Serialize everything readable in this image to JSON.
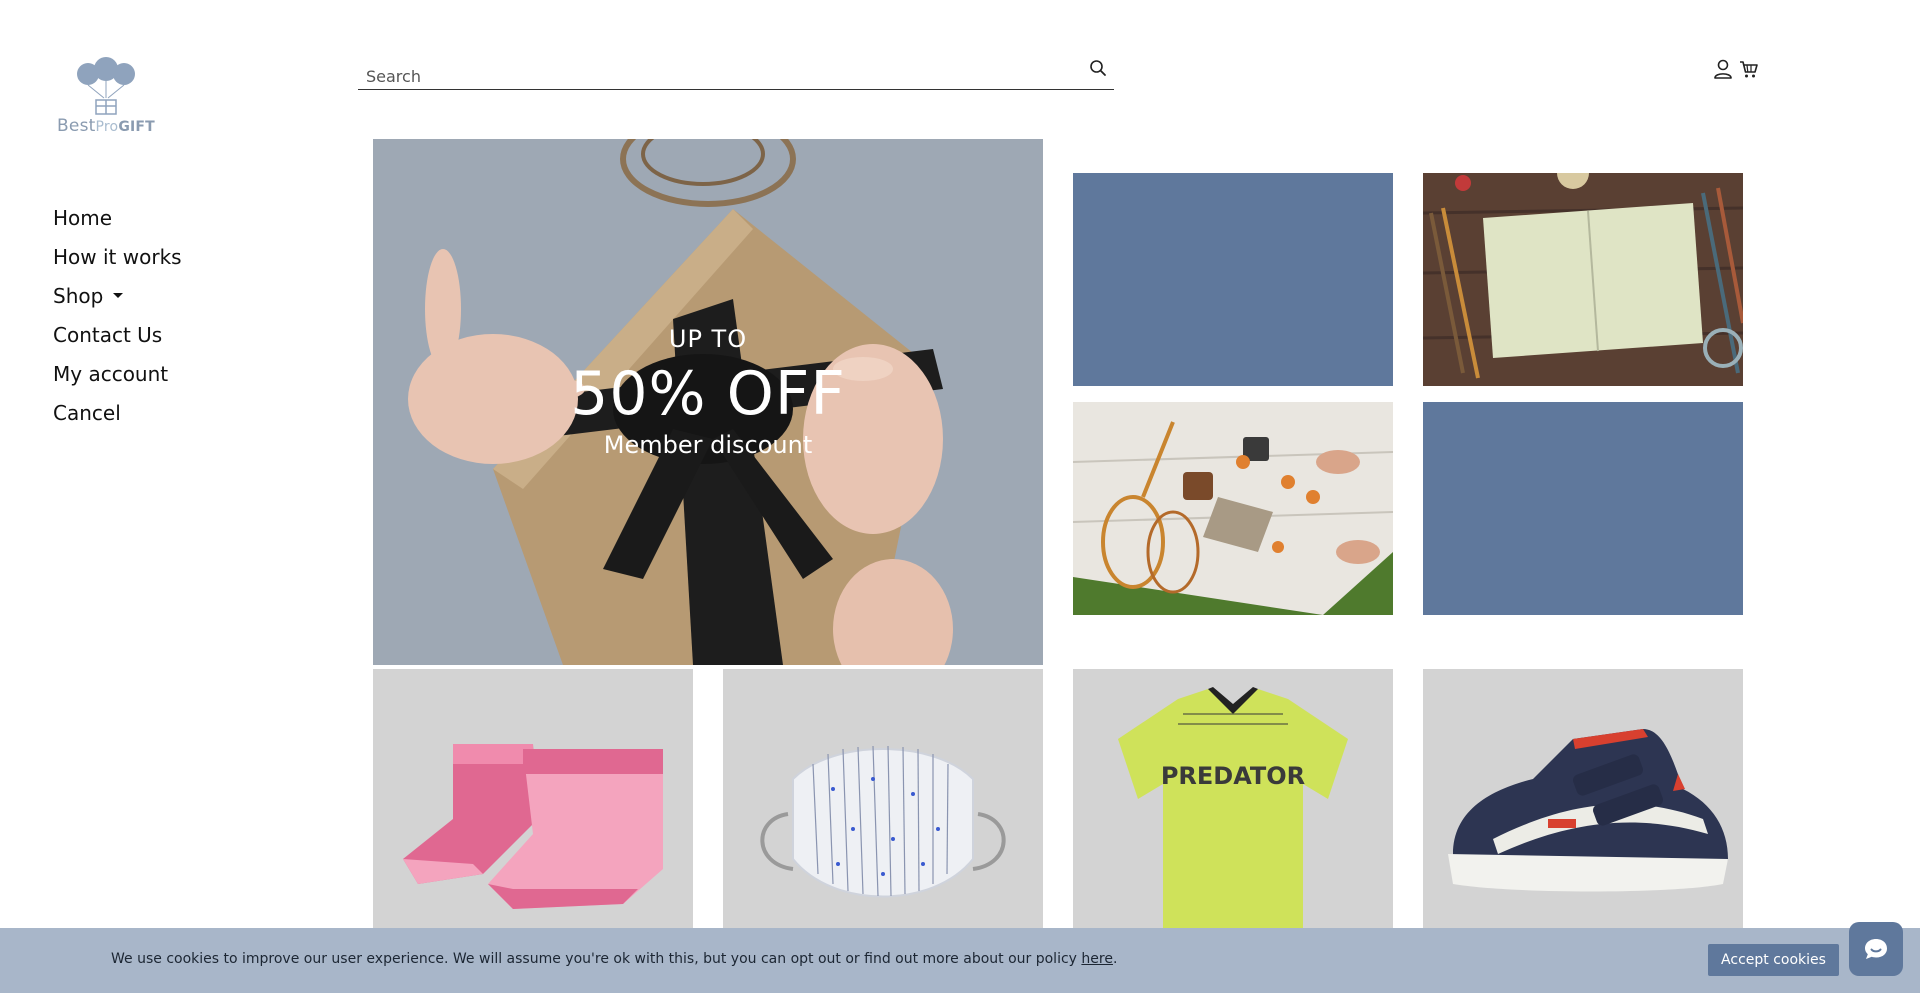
{
  "brand": {
    "name_best": "Best",
    "name_pro": "Pro",
    "name_gift": "GIFT"
  },
  "nav": {
    "items": [
      {
        "label": "Home"
      },
      {
        "label": "How it works"
      },
      {
        "label": "Shop"
      },
      {
        "label": "Contact Us"
      },
      {
        "label": "My account"
      },
      {
        "label": "Cancel"
      }
    ]
  },
  "search": {
    "placeholder": "Search"
  },
  "header": {
    "icons": [
      "user-icon",
      "cart-icon",
      "search-icon"
    ]
  },
  "hero": {
    "line1": "UP TO",
    "line2": "50% OFF",
    "line3": "Member discount"
  },
  "colors": {
    "accent": "#5f789c",
    "cookie_bar": "#a8b6c9",
    "product_bg": "#d3d3d3"
  },
  "cookie": {
    "text": "We use cookies to improve our user experience. We will assume you're ok with this, but you can opt out or find out more about our policy ",
    "link": "here",
    "suffix": ".",
    "button": "Accept cookies"
  }
}
